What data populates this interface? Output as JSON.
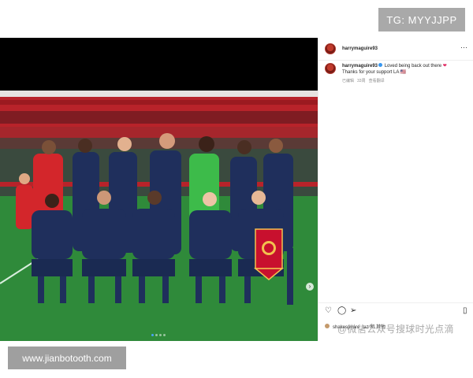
{
  "watermarks": {
    "top": "TG: MYYJJPP",
    "bottom": "www.jianbotooth.com"
  },
  "post": {
    "username": "harrymaguire93",
    "comment": {
      "username": "harrymaguire93",
      "text": "Loved being back out there",
      "text2": "Thanks for your support LA",
      "emoji": "❤",
      "emoji2": "🇺🇸",
      "meta": [
        "已编辑",
        "33周",
        "查看翻译"
      ]
    },
    "carousel": {
      "current": 1,
      "total": 4,
      "next_arrow": "›"
    },
    "actions": {
      "like_icon": "heart-icon",
      "comment_icon": "comment-icon",
      "share_icon": "share-icon",
      "save_icon": "bookmark-icon"
    },
    "liked_by_text": "shakespeare_taz 和 其他",
    "overlay_text": "@微信公众号搜球时光点滴",
    "colors": {
      "kit_navy": "#1f2f5c",
      "keeper_green": "#3dbb4a",
      "staff_red": "#d3262b",
      "pitch_green": "#2f8a3a",
      "banner_red": "#c8102e",
      "verified_blue": "#3897f0"
    }
  }
}
